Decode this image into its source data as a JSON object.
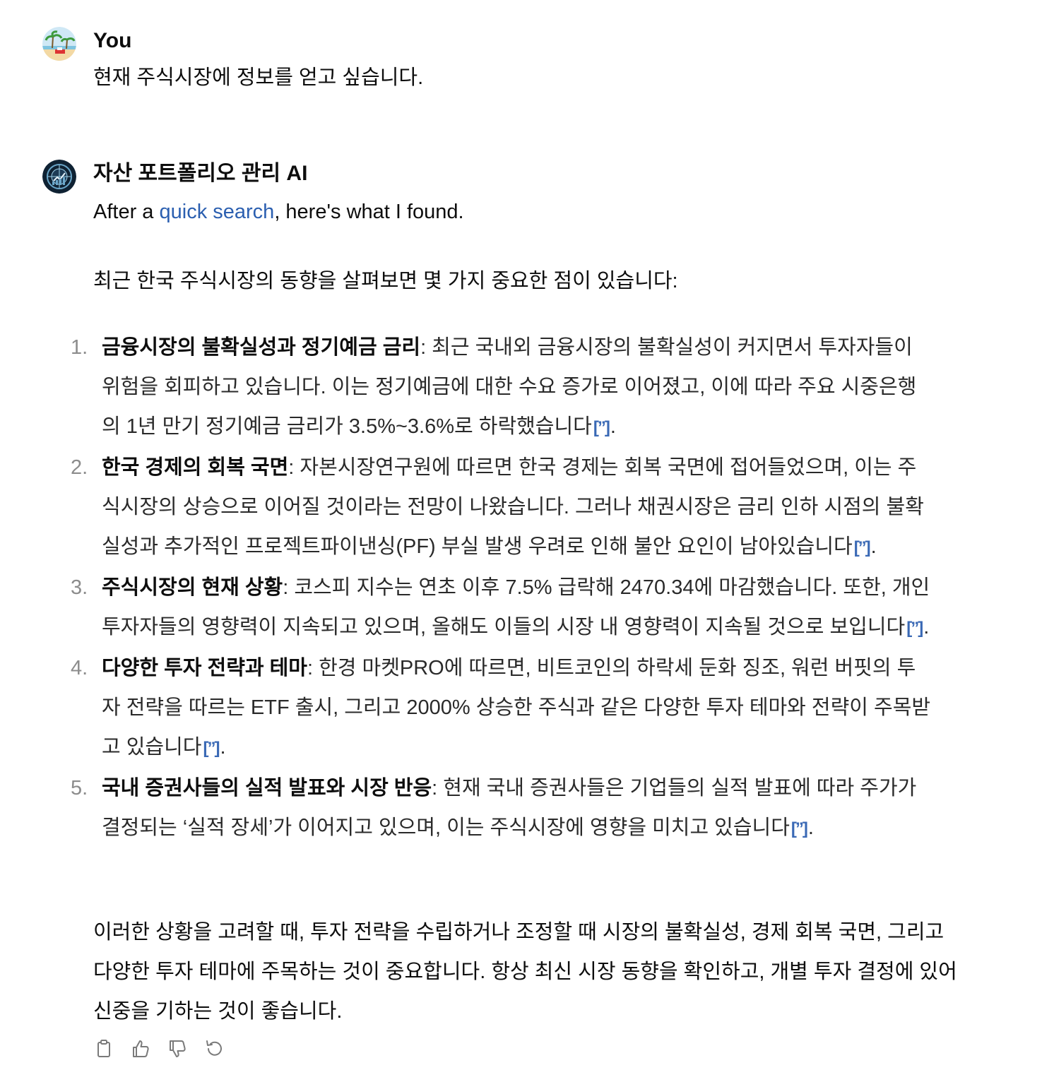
{
  "user": {
    "name": "You",
    "message": "현재 주식시장에 정보를 얻고 싶습니다."
  },
  "assistant": {
    "name": "자산 포트폴리오 관리 AI",
    "intro_prefix": "After a ",
    "intro_link": "quick search",
    "intro_suffix": ", here's what I found.",
    "lead": "최근 한국 주식시장의 동향을 살펴보면 몇 가지 중요한 점이 있습니다:",
    "items": [
      {
        "num": "1.",
        "title": "금융시장의 불확실성과 정기예금 금리",
        "text": ": 최근 국내외 금융시장의 불확실성이 커지면서 투자자들이 위험을 회피하고 있습니다. 이는 정기예금에 대한 수요 증가로 이어졌고, 이에 따라 주요 시중은행의 1년 만기 정기예금 금리가 3.5%~3.6%로 하락했습니다",
        "cite": "[”]",
        "end": "."
      },
      {
        "num": "2.",
        "title": "한국 경제의 회복 국면",
        "text": ": 자본시장연구원에 따르면 한국 경제는 회복 국면에 접어들었으며, 이는 주식시장의 상승으로 이어질 것이라는 전망이 나왔습니다. 그러나 채권시장은 금리 인하 시점의 불확실성과 추가적인 프로젝트파이낸싱(PF) 부실 발생 우려로 인해 불안 요인이 남아있습니다",
        "cite": "[”]",
        "end": "."
      },
      {
        "num": "3.",
        "title": "주식시장의 현재 상황",
        "text": ": 코스피 지수는 연초 이후 7.5% 급락해 2470.34에 마감했습니다. 또한, 개인 투자자들의 영향력이 지속되고 있으며, 올해도 이들의 시장 내 영향력이 지속될 것으로 보입니다",
        "cite": "[”]",
        "end": "."
      },
      {
        "num": "4.",
        "title": "다양한 투자 전략과 테마",
        "text": ": 한경 마켓PRO에 따르면, 비트코인의 하락세 둔화 징조, 워런 버핏의 투자 전략을 따르는 ETF 출시, 그리고 2000% 상승한 주식과 같은 다양한 투자 테마와 전략이 주목받고 있습니다",
        "cite": "[”]",
        "end": "."
      },
      {
        "num": "5.",
        "title": "국내 증권사들의 실적 발표와 시장 반응",
        "text": ": 현재 국내 증권사들은 기업들의 실적 발표에 따라 주가가 결정되는 ‘실적 장세’가 이어지고 있으며, 이는 주식시장에 영향을 미치고 있습니다",
        "cite": "[”]",
        "end": "."
      }
    ],
    "outro": "이러한 상황을 고려할 때, 투자 전략을 수립하거나 조정할 때 시장의 불확실성, 경제 회복 국면, 그리고 다양한 투자 테마에 주목하는 것이 중요합니다. 항상 최신 시장 동향을 확인하고, 개별 투자 결정에 있어 신중을 기하는 것이 좋습니다."
  },
  "actions": [
    {
      "icon": "copy-icon"
    },
    {
      "icon": "thumbs-up-icon"
    },
    {
      "icon": "thumbs-down-icon"
    },
    {
      "icon": "regenerate-icon"
    }
  ],
  "colors": {
    "link": "#2b5fb0",
    "citation": "#3a69b5",
    "list_number": "#8c8c8c"
  }
}
